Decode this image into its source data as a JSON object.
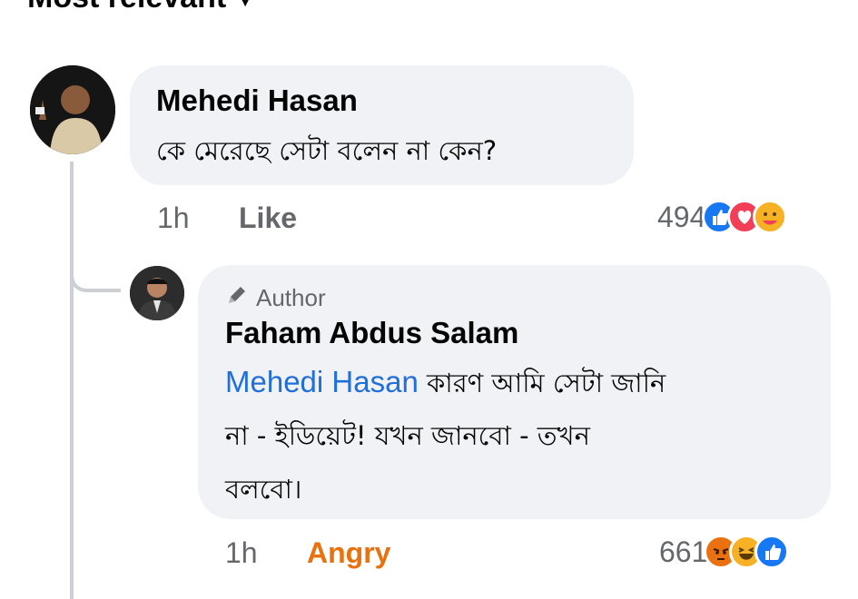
{
  "sort": {
    "label": "Most relevant"
  },
  "comments": [
    {
      "author": "Mehedi Hasan",
      "text": "কে মেরেছে সেটা বলেন না কেন?",
      "time": "1h",
      "action": "Like",
      "reaction_count": "494",
      "reactions": [
        "like-icon",
        "love-icon",
        "care-icon"
      ]
    }
  ],
  "reply": {
    "badge": "Author",
    "author": "Faham Abdus Salam",
    "mention": "Mehedi Hasan",
    "line1": " কারণ আমি সেটা জানি",
    "line2": "না - ইডিয়েট! যখন জানবো - তখন",
    "line3": "বলবো।",
    "time": "1h",
    "action": "Angry",
    "reaction_count": "661",
    "reactions": [
      "angry-icon",
      "haha-icon",
      "like-icon"
    ]
  },
  "colors": {
    "bubble": "#f0f2f5",
    "mention": "#216fdb",
    "meta": "#65676b",
    "angry": "#e9710f",
    "like": "#1877f2",
    "love": "#f33e58"
  }
}
